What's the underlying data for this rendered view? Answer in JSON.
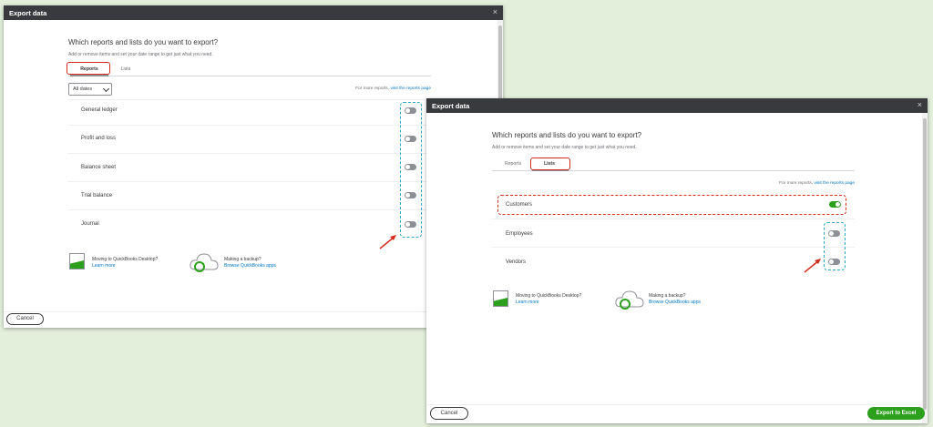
{
  "dialog_left": {
    "title": "Export data",
    "close_glyph": "×",
    "heading": "Which reports and lists do you want to export?",
    "subtext": "Add or remove items and set your date range to get just what you need.",
    "tabs": [
      {
        "label": "Reports",
        "active": true
      },
      {
        "label": "Lists",
        "active": false
      }
    ],
    "date_select": "All dates",
    "more_reports_text": "For more reports, ",
    "more_reports_link": "visit the reports page",
    "items": [
      {
        "label": "General ledger",
        "on": false
      },
      {
        "label": "Profit and loss",
        "on": false
      },
      {
        "label": "Balance sheet",
        "on": false
      },
      {
        "label": "Trial balance",
        "on": false
      },
      {
        "label": "Journal",
        "on": false
      }
    ],
    "promo_desktop_title": "Moving to QuickBooks Desktop?",
    "promo_desktop_link": "Learn more",
    "promo_backup_title": "Making a backup?",
    "promo_backup_link": "Browse QuickBooks apps",
    "cancel_label": "Cancel"
  },
  "dialog_right": {
    "title": "Export data",
    "close_glyph": "×",
    "heading": "Which reports and lists do you want to export?",
    "subtext": "Add or remove items and set your date range to get just what you need.",
    "tabs": [
      {
        "label": "Reports",
        "active": false
      },
      {
        "label": "Lists",
        "active": true
      }
    ],
    "more_reports_text": "For more reports, ",
    "more_reports_link": "visit the reports page",
    "items": [
      {
        "label": "Customers",
        "on": true
      },
      {
        "label": "Employees",
        "on": false
      },
      {
        "label": "Vendors",
        "on": false
      }
    ],
    "promo_desktop_title": "Moving to QuickBooks Desktop?",
    "promo_desktop_link": "Learn more",
    "promo_backup_title": "Making a backup?",
    "promo_backup_link": "Browse QuickBooks apps",
    "cancel_label": "Cancel",
    "export_label": "Export to Excel"
  },
  "colors": {
    "header": "#393a3d",
    "toggle_on": "#2ca01c",
    "toggle_off": "#8d9096",
    "link": "#0077c5",
    "annotation_red": "#d52b1e",
    "annotation_teal": "#27a6c6",
    "background": "#e3eedb"
  }
}
